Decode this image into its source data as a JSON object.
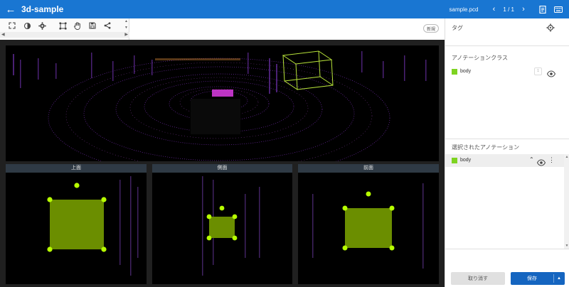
{
  "app": {
    "title": "3d-sample",
    "file_name": "sample.pcd",
    "page_indicator": "1 / 1",
    "prev_icon": "chevron-left-icon",
    "next_icon": "chevron-right-icon"
  },
  "toolbar": {
    "tools": [
      "fullscreen-icon",
      "brightness-icon",
      "settings-icon",
      "fit-box-icon",
      "hand-icon",
      "save-icon",
      "share-icon"
    ],
    "new_label": "新規"
  },
  "views": {
    "top_label": "上面",
    "side_label": "側面",
    "front_label": "前面"
  },
  "sidebar": {
    "tags_title": "タグ",
    "classes_title": "アノテーションクラス",
    "classes": [
      {
        "label": "body",
        "color": "#7ed321",
        "count": "1"
      }
    ],
    "selected_title": "選択されたアノテーション",
    "selected": [
      {
        "label": "body",
        "color": "#7ed321"
      }
    ]
  },
  "footer": {
    "cancel_label": "取り消す",
    "save_label": "保存"
  },
  "colors": {
    "appbar": "#1976d2",
    "annotation_fill": "#6b8e00",
    "annotation_handle": "#b7ff00"
  }
}
